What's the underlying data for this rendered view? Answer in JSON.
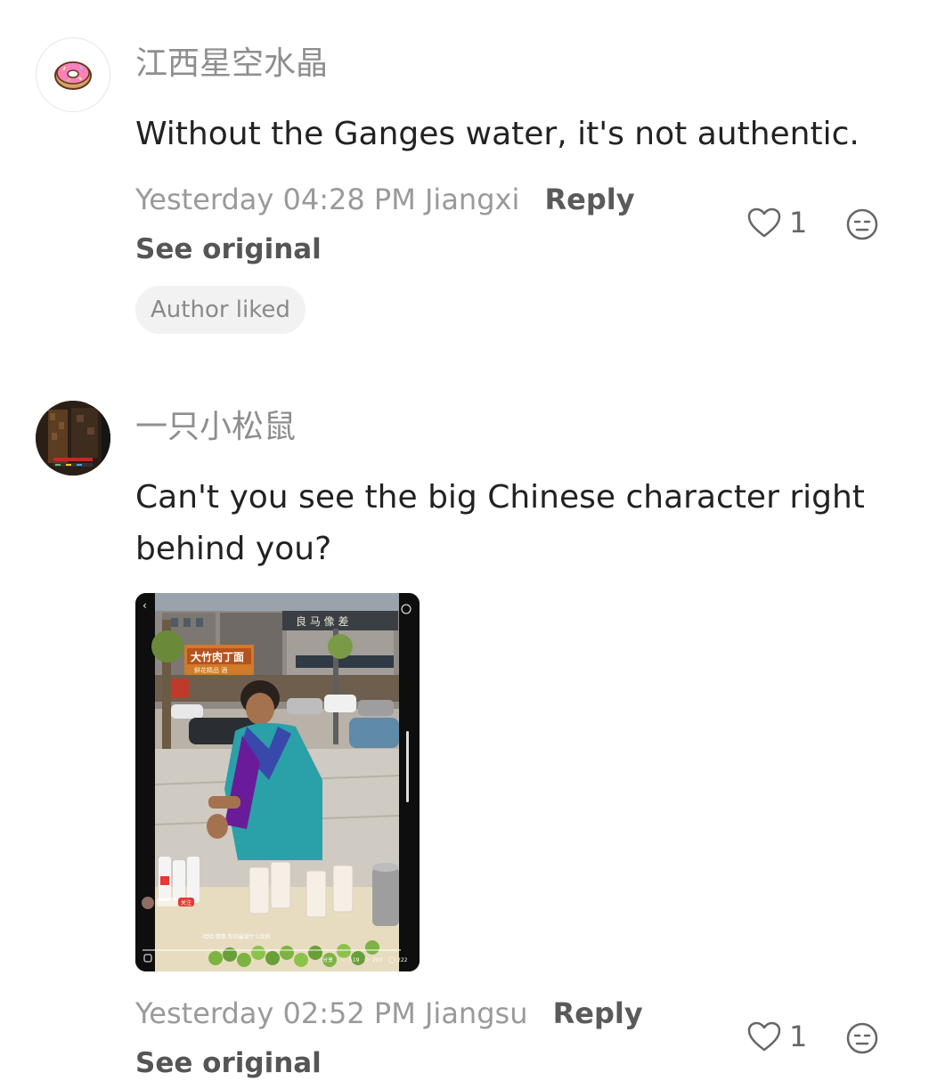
{
  "comments": [
    {
      "username": "江西星空水晶",
      "text": "Without the Ganges water, it's not authentic.",
      "timestamp": "Yesterday 04:28 PM",
      "location": "Jiangxi",
      "reply_label": "Reply",
      "see_original_label": "See original",
      "badge": "Author liked",
      "like_count": "1",
      "avatar_icon": "donut-icon"
    },
    {
      "username": "一只小松鼠",
      "text": "Can't you see the big Chinese character right behind you?",
      "timestamp": "Yesterday 02:52 PM",
      "location": "Jiangsu",
      "reply_label": "Reply",
      "see_original_label": "See original",
      "like_count": "1",
      "avatar_icon": "game-scene-avatar",
      "attached_image": {
        "shop_sign": "大竹肉丁面",
        "shop_sign_sub": "鲜花精品 酒",
        "upper_sign": "良 马 像 差",
        "caption": "哈哈 情事 你的最爱什么饮料",
        "like_count": "519",
        "favorite_count": "203",
        "comment_count": "222",
        "share_label": "分享",
        "follow_label": "关注"
      }
    }
  ],
  "colors": {
    "text": "#222222",
    "muted": "#9a9a9a",
    "reply": "#5a5a5a",
    "badge_bg": "#f2f2f2"
  }
}
